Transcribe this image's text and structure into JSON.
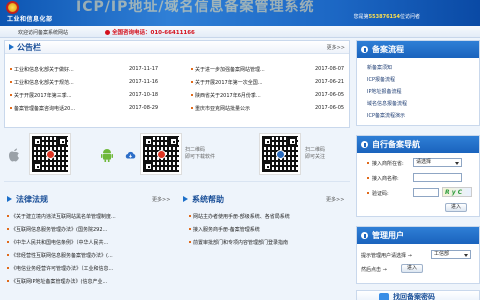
{
  "header": {
    "ministry_name": "工业和信息化部",
    "site_title": "ICP/IP地址/域名信息备案管理系统",
    "welcome_prefix": "您是第",
    "visitor_number": "553876154",
    "welcome_suffix": "位访问者"
  },
  "topbar": {
    "welcome_text": "欢迎访问备案系统网站",
    "hotline": "全国咨询电话：010-66411166"
  },
  "announcements": {
    "title": "公告栏",
    "more": "更多>>",
    "left": [
      {
        "text": "工业和信息化部关于做好...",
        "date": "2017-11-17"
      },
      {
        "text": "工业和信息化部关于规范...",
        "date": "2017-11-16"
      },
      {
        "text": "关于开展2017年第三季...",
        "date": "2017-10-18"
      },
      {
        "text": "备案管理备案咨询电话20...",
        "date": "2017-08-29"
      }
    ],
    "right": [
      {
        "text": "关于进一步加强备案网站管理...",
        "date": "2017-08-07"
      },
      {
        "text": "关于开展2017年第一次全国...",
        "date": "2017-06-21"
      },
      {
        "text": "陕西省关于2017年6月份季...",
        "date": "2017-06-05"
      },
      {
        "text": "重庆市亚克网站批量公示",
        "date": "2017-06-05"
      }
    ]
  },
  "apps": {
    "ios_caption_line1": "扫二维码",
    "ios_caption_line2": "即可下载软件",
    "wechat_caption_line1": "扫二维码",
    "wechat_caption_line2": "即可关注"
  },
  "law": {
    "title": "法律法规",
    "more": "更多>>",
    "items": [
      "《关于建立境内违法互联网站黑名单管理制度...",
      "《互联网信息服务管理办法》(国务院292...",
      "《中华人民共和国电信条例》（中华人民共...",
      "《非经营性互联网信息服务备案管理办法》(...",
      "《电信业务经营许可管理办法》（工业和信息...",
      "《互联网IP地址备案管理办法》(信息产业..."
    ]
  },
  "help": {
    "title": "系统帮助",
    "more": "更多>>",
    "items": [
      "网站主办者使用手册-部级系统、各省局系统",
      "接入服务商手册-备案管理系统",
      "前置审批部门和专项内容管理部门登录指南"
    ]
  },
  "sidebar": {
    "flow_title": "备案流程",
    "flow_links": [
      "新备案须知",
      "ICP报备流程",
      "IP地址报备流程",
      "域名信息报备流程",
      "ICP备案流程演示"
    ],
    "self_title": "自行备案导航",
    "label_province": "接入商所在省:",
    "province_value": "请选择",
    "label_user": "接入商名称:",
    "label_code": "验证码:",
    "captcha_text": "R y C",
    "go_label": "进入",
    "manage_title": "管理用户",
    "label_manage": "提示管理用户请选择 →",
    "manage_value": "工信部",
    "label_enter": "然后点击 →",
    "enter_label": "进入",
    "banner_title": "找回备案密码"
  },
  "colors": {
    "brand_blue": "#1c67c4",
    "heading_blue": "#1a4f98",
    "accent_red": "#d4101c",
    "bullet_orange": "#e06a1b"
  }
}
